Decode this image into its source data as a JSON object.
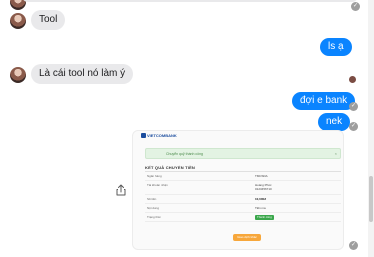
{
  "messages": {
    "m1": {
      "text": "Tool"
    },
    "m2": {
      "text": "ls ạ"
    },
    "m3": {
      "text": "Là cái tool nó làm ý"
    },
    "m4": {
      "text": "đợi e bank"
    },
    "m5": {
      "text": "nek"
    }
  },
  "status": {
    "sent_glyph": "✓"
  },
  "receipt": {
    "logo": "VIETCOMBANK",
    "alert": "Chuyển quỹ thành công",
    "alert_close": "×",
    "heading": "KẾT QUẢ CHUYỂN TIỀN",
    "rows": [
      {
        "label": "Ngân hàng",
        "value": "TMCSDA"
      },
      {
        "label": "Tài khoản nhận",
        "value": "Hoàng Phúc 0123456710"
      },
      {
        "label": "Số tiền",
        "value": "10,000đ"
      },
      {
        "label": "Nội dung",
        "value": "Tiền ma"
      },
      {
        "label": "Trạng thái",
        "value": "Thành công"
      }
    ],
    "button": "Giao dịch khác"
  },
  "colors": {
    "outgoing_bubble": "#0a84ff",
    "incoming_bubble": "#e9e9eb",
    "success_badge": "#3aa74b",
    "receipt_button": "#f7a73b"
  },
  "icons": {
    "share": "share-icon",
    "sent": "checkmark-circle-icon"
  }
}
